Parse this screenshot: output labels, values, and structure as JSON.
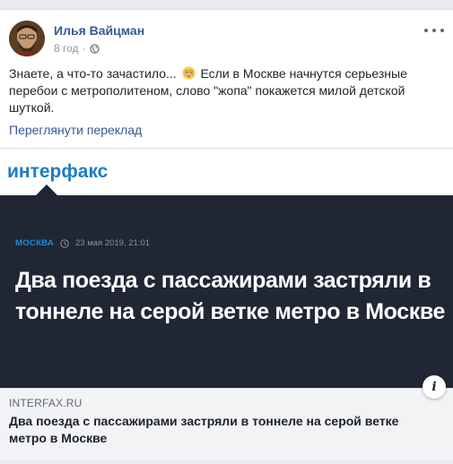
{
  "post": {
    "author": "Илья Вайцман",
    "time": "8 год",
    "separator": "·",
    "text_part1": "Знаете, а что-то зачастило...",
    "text_part2": "Если в Москве начнутся серьезные перебои с метрополитеном, слово \"жопа\" покажется милой детской шуткой.",
    "translate_link": "Переглянути переклад",
    "icons": {
      "avatar": "avatar",
      "privacy": "globe-icon",
      "more": "more-options-icon",
      "emoji": "flushed-face-emoji"
    }
  },
  "link_card": {
    "source_logo": "интерфакс",
    "section": "МОСКВА",
    "date": "23 мая 2019, 21:01",
    "headline": "Два поезда с пассажирами застряли в тоннеле на серой ветке метро в Москве",
    "domain": "INTERFAX.RU",
    "title": "Два поезда с пассажирами застряли в тоннеле на серой ветке метро в Москве",
    "info_symbol": "i"
  },
  "colors": {
    "author": "#365899",
    "link": "#385898",
    "dark_bg": "#202634",
    "logo": "#1a7dc7",
    "section_tag": "#1a8fd6",
    "caption_bg": "#f2f3f5"
  }
}
